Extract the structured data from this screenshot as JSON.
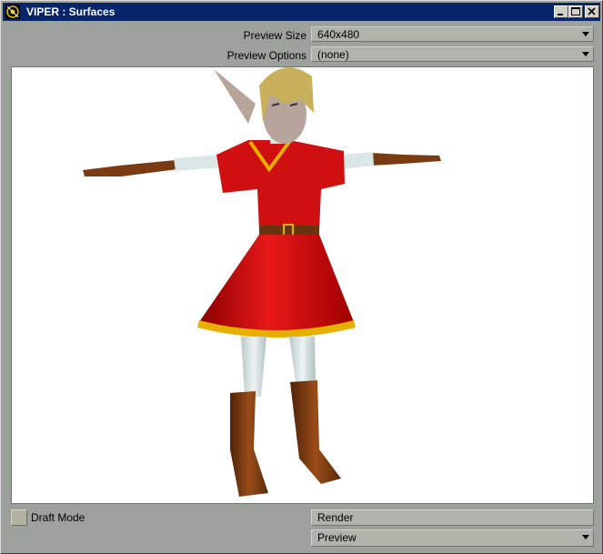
{
  "window": {
    "title": "VIPER : Surfaces",
    "minimize_icon": "minimize-icon",
    "maximize_icon": "maximize-icon",
    "close_icon": "close-icon",
    "app_icon": "viper-app-icon"
  },
  "controls": {
    "preview_size_label": "Preview Size",
    "preview_size_value": "640x480",
    "preview_options_label": "Preview Options",
    "preview_options_value": "(none)"
  },
  "viewport": {
    "content": "3D character render preview"
  },
  "bottom": {
    "draft_mode_label": "Draft Mode",
    "render_label": "Render",
    "preview_value": "Preview"
  },
  "colors": {
    "titlebar": "#08246b",
    "panel": "#9ca19c",
    "tunic": "#d01010",
    "trim": "#e6b000",
    "boots": "#7a3b12",
    "tights": "#d8e4e4",
    "hair": "#c9b05a",
    "skin": "#b7a49b"
  }
}
